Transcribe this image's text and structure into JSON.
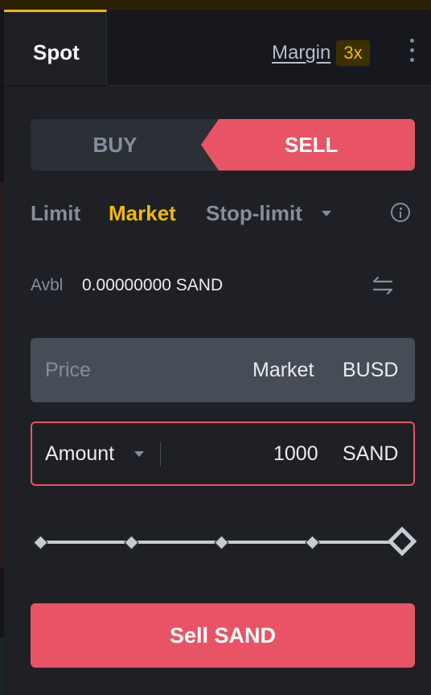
{
  "tabs": {
    "spot": "Spot",
    "margin": "Margin",
    "leverage_badge": "3x"
  },
  "side_toggle": {
    "buy": "BUY",
    "sell": "SELL",
    "selected": "SELL"
  },
  "order_types": {
    "limit": "Limit",
    "market": "Market",
    "stop_limit": "Stop-limit",
    "active": "Market"
  },
  "balance": {
    "label": "Avbl",
    "value": "0.00000000 SAND"
  },
  "price_field": {
    "placeholder": "Price",
    "value": "Market",
    "unit": "BUSD"
  },
  "amount_field": {
    "label": "Amount",
    "value": "1000",
    "unit": "SAND"
  },
  "slider": {
    "steps": [
      0,
      25,
      50,
      75,
      100
    ],
    "value_percent": 100
  },
  "submit": {
    "label": "Sell SAND"
  },
  "colors": {
    "accent_yellow": "#f0b90b",
    "sell_red": "#e85465",
    "background": "#1e2026",
    "muted_text": "#848e9c"
  },
  "icons": [
    "more-vertical-icon",
    "caret-down-icon",
    "info-icon",
    "swap-icon",
    "caret-down-icon"
  ]
}
